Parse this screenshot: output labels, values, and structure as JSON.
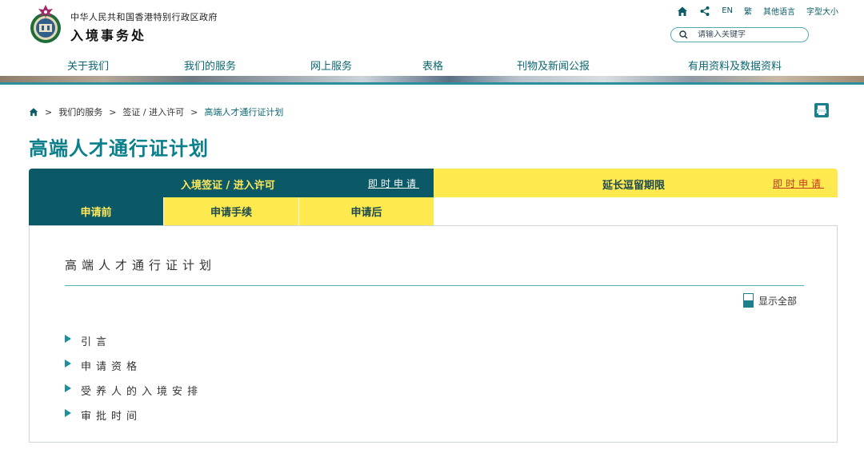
{
  "header": {
    "gov_name": "中华人民共和国香港特别行政区政府",
    "dept_name": "入境事务处",
    "top_links": {
      "home_icon": "home-icon",
      "share_icon": "share-icon",
      "en": "EN",
      "trad": "繁",
      "other_lang": "其他语言",
      "font_size": "字型大小"
    },
    "search": {
      "placeholder": "请输入关键字",
      "icon": "search-icon"
    }
  },
  "nav": {
    "items": [
      {
        "label": "关于我们"
      },
      {
        "label": "我们的服务"
      },
      {
        "label": "网上服务"
      },
      {
        "label": "表格"
      },
      {
        "label": "刊物及新闻公报"
      },
      {
        "label": "有用资料及数据资料"
      }
    ]
  },
  "breadcrumb": {
    "home_icon": "home-icon",
    "items": [
      "我们的服务",
      "签证 / 进入许可",
      "高端人才通行证计划"
    ],
    "separator": ">"
  },
  "page": {
    "title": "高端人才通行证计划",
    "print_icon": "print-icon"
  },
  "tabs": {
    "primary": [
      {
        "label": "入境签证 / 进入许可",
        "apply": "即时申请"
      },
      {
        "label": "延长逗留期限",
        "apply": "即时申请"
      }
    ],
    "sub": [
      {
        "label": "申请前"
      },
      {
        "label": "申请手续"
      },
      {
        "label": "申请后"
      }
    ]
  },
  "content": {
    "title": "高端人才通行证计划",
    "show_all": "显示全部",
    "accordion": [
      {
        "label": "引言"
      },
      {
        "label": "申请资格"
      },
      {
        "label": "受养人的入境安排"
      },
      {
        "label": "审批时间"
      }
    ]
  },
  "colors": {
    "teal_dark": "#0b5966",
    "teal_text": "#0a7f8c",
    "yellow": "#fee94f",
    "yellow_text": "#ffe85a",
    "red_link": "#c8361f"
  }
}
